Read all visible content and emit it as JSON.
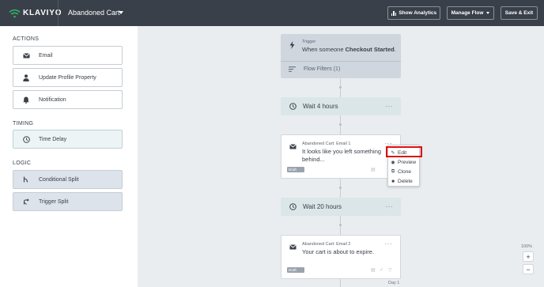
{
  "brand": {
    "name": "KLAVIYO",
    "accent": "#2fb56a"
  },
  "header": {
    "flow_title": "Abandoned Cart",
    "show_analytics": "Show Analytics",
    "manage_flow": "Manage Flow",
    "save_exit": "Save & Exit"
  },
  "sidebar": {
    "actions_label": "ACTIONS",
    "actions": [
      {
        "label": "Email",
        "icon": "envelope-icon"
      },
      {
        "label": "Update Profile Property",
        "icon": "person-icon"
      },
      {
        "label": "Notification",
        "icon": "bell-icon"
      }
    ],
    "timing_label": "TIMING",
    "timing": [
      {
        "label": "Time Delay",
        "icon": "clock-icon"
      }
    ],
    "logic_label": "LOGIC",
    "logic": [
      {
        "label": "Conditional Split",
        "icon": "split-icon"
      },
      {
        "label": "Trigger Split",
        "icon": "trigger-split-icon"
      }
    ]
  },
  "flow": {
    "trigger": {
      "caption": "Trigger",
      "prefix": "When someone ",
      "event": "Checkout Started",
      "suffix": ".",
      "filters": "Flow Filters (1)"
    },
    "wait1": "Wait 4 hours",
    "email1": {
      "caption": "Abandoned Cart: Email 1",
      "body": "It looks like you left something behind...",
      "status": "Draft"
    },
    "wait2": "Wait 20 hours",
    "email2": {
      "caption": "Abandoned Cart: Email 2",
      "body": "Your cart is about to expire.",
      "status": "Draft"
    },
    "more": "···"
  },
  "context_menu": {
    "edit": "Edit",
    "preview": "Preview",
    "clone": "Clone",
    "delete": "Delete"
  },
  "zoom": {
    "level": "100%",
    "plus": "+",
    "minus": "−"
  },
  "bottom_label": "Day 1"
}
